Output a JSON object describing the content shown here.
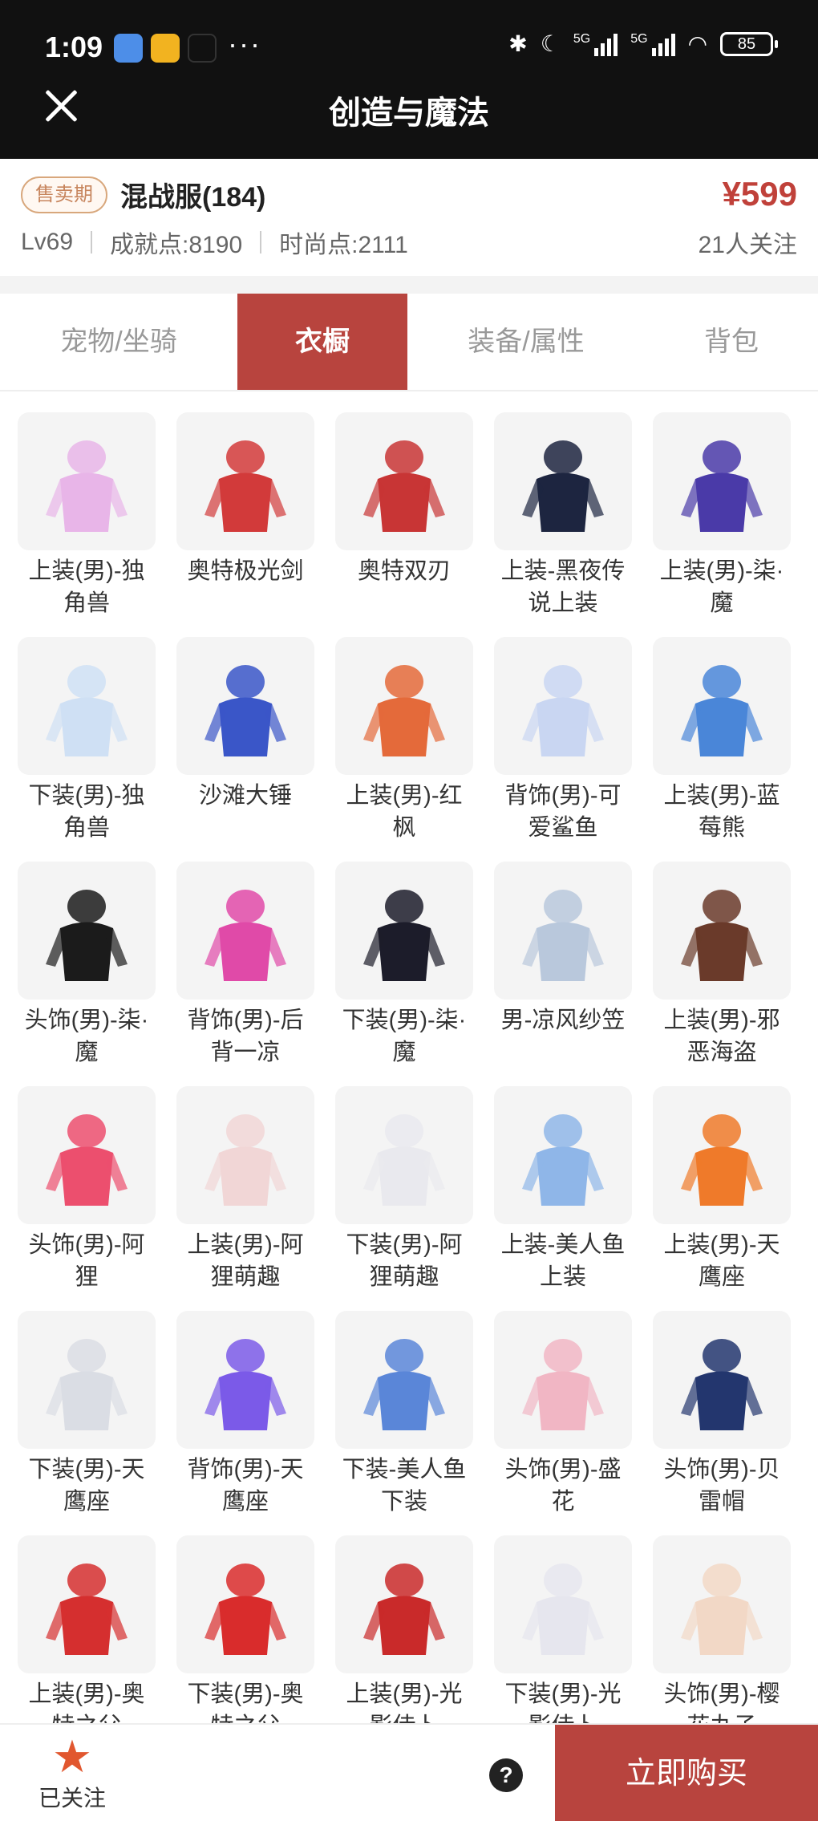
{
  "status_bar": {
    "time": "1:09",
    "network_1": "5G",
    "network_2": "5G",
    "battery": "85"
  },
  "header": {
    "title": "创造与魔法"
  },
  "listing": {
    "badge": "售卖期",
    "name": "混战服(184)",
    "price": "¥599",
    "level": "Lv69",
    "achievement": "成就点:8190",
    "fashion": "时尚点:2111",
    "followers": "21人关注"
  },
  "tabs": [
    {
      "label": "宠物/坐骑",
      "active": false
    },
    {
      "label": "衣橱",
      "active": true
    },
    {
      "label": "装备/属性",
      "active": false
    },
    {
      "label": "背包",
      "active": false
    }
  ],
  "items": [
    {
      "label": "上装(男)-独角兽",
      "icon": "winged-top-icon",
      "color": "#e8b5e8"
    },
    {
      "label": "奥特极光剑",
      "icon": "sword-icon",
      "color": "#d23a3a"
    },
    {
      "label": "奥特双刃",
      "icon": "twin-blades-icon",
      "color": "#c83535"
    },
    {
      "label": "上装-黑夜传说上装",
      "icon": "dark-coat-icon",
      "color": "#1d2540"
    },
    {
      "label": "上装(男)-柒·魔",
      "icon": "purple-coat-icon",
      "color": "#4a3aa8"
    },
    {
      "label": "下装(男)-独角兽",
      "icon": "white-shoes-icon",
      "color": "#cfe0f4"
    },
    {
      "label": "沙滩大锤",
      "icon": "hammer-icon",
      "color": "#3a56c8"
    },
    {
      "label": "上装(男)-红枫",
      "icon": "maple-top-icon",
      "color": "#e46a3a"
    },
    {
      "label": "背饰(男)-可爱鲨鱼",
      "icon": "shark-icon",
      "color": "#c9d6f2"
    },
    {
      "label": "上装(男)-蓝莓熊",
      "icon": "blue-jacket-icon",
      "color": "#4a86d8"
    },
    {
      "label": "头饰(男)-柒·魔",
      "icon": "dark-hair-icon",
      "color": "#1b1b1b"
    },
    {
      "label": "背饰(男)-后背一凉",
      "icon": "ice-cream-icon",
      "color": "#e04aa8"
    },
    {
      "label": "下装(男)-柒·魔",
      "icon": "dark-pants-icon",
      "color": "#1c1c2a"
    },
    {
      "label": "男-凉风纱笠",
      "icon": "veil-hat-icon",
      "color": "#b9c8dc"
    },
    {
      "label": "上装(男)-邪恶海盗",
      "icon": "pirate-coat-icon",
      "color": "#6a3a2a"
    },
    {
      "label": "头饰(男)-阿狸",
      "icon": "fox-head-icon",
      "color": "#ec4f6e"
    },
    {
      "label": "上装(男)-阿狸萌趣",
      "icon": "fox-jacket-icon",
      "color": "#f1d6d6"
    },
    {
      "label": "下装(男)-阿狸萌趣",
      "icon": "white-pants-icon",
      "color": "#e9e9ee"
    },
    {
      "label": "上装-美人鱼上装",
      "icon": "mermaid-top-icon",
      "color": "#8fb6e8"
    },
    {
      "label": "上装(男)-天鹰座",
      "icon": "orange-jacket-icon",
      "color": "#ef7a2a"
    },
    {
      "label": "下装(男)-天鹰座",
      "icon": "armor-pants-icon",
      "color": "#dadde4"
    },
    {
      "label": "背饰(男)-天鹰座",
      "icon": "robot-backpack-icon",
      "color": "#7b5ae8"
    },
    {
      "label": "下装-美人鱼下装",
      "icon": "mermaid-skirt-icon",
      "color": "#5a86d8"
    },
    {
      "label": "头饰(男)-盛花",
      "icon": "pink-hair-icon",
      "color": "#f1b6c4"
    },
    {
      "label": "头饰(男)-贝雷帽",
      "icon": "beret-icon",
      "color": "#23366e"
    },
    {
      "label": "上装(男)-奥特之父",
      "icon": "ultra-top-icon",
      "color": "#d52f2f"
    },
    {
      "label": "下装(男)-奥特之父",
      "icon": "ultra-boots-icon",
      "color": "#d92c2c"
    },
    {
      "label": "上装(男)-光影侍卜",
      "icon": "red-jacket-icon",
      "color": "#c92a2a"
    },
    {
      "label": "下装(男)-光影侍卜",
      "icon": "light-pants-icon",
      "color": "#e6e6ee"
    },
    {
      "label": "头饰(男)-樱花丸子",
      "icon": "sakura-hair-icon",
      "color": "#f2d8c6"
    }
  ],
  "bottom": {
    "follow_label": "已关注",
    "help": "?",
    "buy_label": "立即购买"
  }
}
